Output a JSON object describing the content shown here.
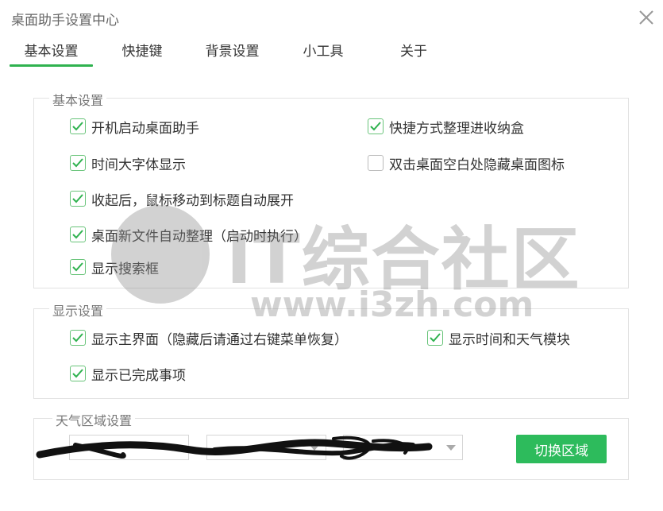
{
  "window": {
    "title": "桌面助手设置中心"
  },
  "tabs": [
    {
      "label": "基本设置",
      "active": true
    },
    {
      "label": "快捷键"
    },
    {
      "label": "背景设置"
    },
    {
      "label": "小工具"
    },
    {
      "label": "关于"
    }
  ],
  "basic_group": {
    "legend": "基本设置",
    "items": [
      {
        "label": "开机启动桌面助手",
        "checked": true
      },
      {
        "label": "快捷方式整理进收纳盒",
        "checked": true
      },
      {
        "label": "时间大字体显示",
        "checked": true
      },
      {
        "label": "双击桌面空白处隐藏桌面图标",
        "checked": false
      },
      {
        "label": "收起后，鼠标移动到标题自动展开",
        "checked": true
      },
      {
        "label": "桌面新文件自动整理（启动时执行）",
        "checked": true
      },
      {
        "label": "显示搜索框",
        "checked": true
      }
    ]
  },
  "display_group": {
    "legend": "显示设置",
    "items": [
      {
        "label": "显示主界面（隐藏后请通过右键菜单恢复）",
        "checked": true
      },
      {
        "label": "显示时间和天气模块",
        "checked": true
      },
      {
        "label": "显示已完成事项",
        "checked": true
      }
    ]
  },
  "weather_group": {
    "legend": "天气区域设置",
    "switch_label": "切换区域"
  },
  "watermark": {
    "text": "IT综合社区",
    "url": "www.i3zh.com"
  },
  "colors": {
    "accent": "#2fb24f",
    "button": "#2dbb5c"
  }
}
